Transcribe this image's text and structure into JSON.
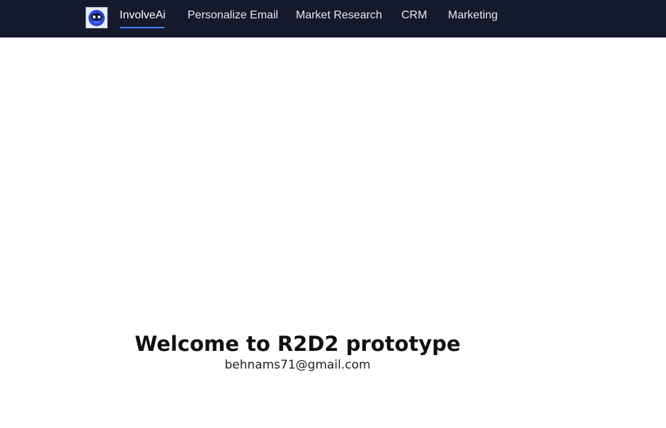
{
  "header": {
    "logo_icon": "robot-face-icon",
    "nav": [
      {
        "label": "InvolveAi",
        "active": true
      },
      {
        "label": "Personalize Email",
        "active": false
      },
      {
        "label": "Market Research",
        "active": false
      },
      {
        "label": "CRM",
        "active": false
      },
      {
        "label": "Marketing",
        "active": false
      }
    ],
    "colors": {
      "background": "#141a2b",
      "active_underline": "#3b82f6",
      "text": "#e6e9f0"
    }
  },
  "main": {
    "title": "Welcome to R2D2 prototype",
    "user_email": "behnams71@gmail.com"
  }
}
